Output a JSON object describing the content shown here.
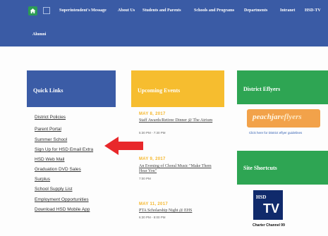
{
  "nav": {
    "items": [
      "Superintendent's Message",
      "About Us",
      "Students and Parents",
      "Schools and Programs",
      "Departments",
      "Intranet",
      "HSD-TV"
    ],
    "second_row": "Alumni"
  },
  "quick_links": {
    "title": "Quick Links",
    "items": [
      "District Policies",
      "Parent Portal",
      "Summer School",
      "Sign Up for HSD Email Extra",
      "HSD Web Mail",
      "Graduation DVD Sales",
      "Surplus",
      "School Supply List",
      "Employment Opportunities",
      "Download HSD Mobile App"
    ]
  },
  "events": {
    "title": "Upcoming Events",
    "items": [
      {
        "date": "MAY 8, 2017",
        "title": "Staff Awards/Retiree Dinner @ The Atrium",
        "time": "5:30 PM - 7:30 PM"
      },
      {
        "date": "MAY 9, 2017",
        "title": "An Evening of Choral Music \"Make Them Hear You\"",
        "time": "7:00 PM"
      },
      {
        "date": "MAY 11, 2017",
        "title": "PTA Scholarship Night @ EHS",
        "time": "6:30 PM - 8:00 PM"
      }
    ]
  },
  "eflyers": {
    "title": "District Eflyers",
    "logo_main": "peachjar",
    "logo_suffix": "eflyers",
    "link": "Click here for District eflyer guidelines"
  },
  "shortcuts": {
    "title": "Site Shortcuts",
    "logo_letters": "HSD",
    "logo_tv": "TV",
    "caption": "Charter Channel 99"
  },
  "colors": {
    "nav": "#3a5ba5",
    "quick_links": "#3b5ca6",
    "events": "#f6bd2f",
    "eflyers": "#2ea553",
    "arrow": "#e8282b"
  },
  "icons": [
    "home-icon",
    "arrow-icon"
  ]
}
